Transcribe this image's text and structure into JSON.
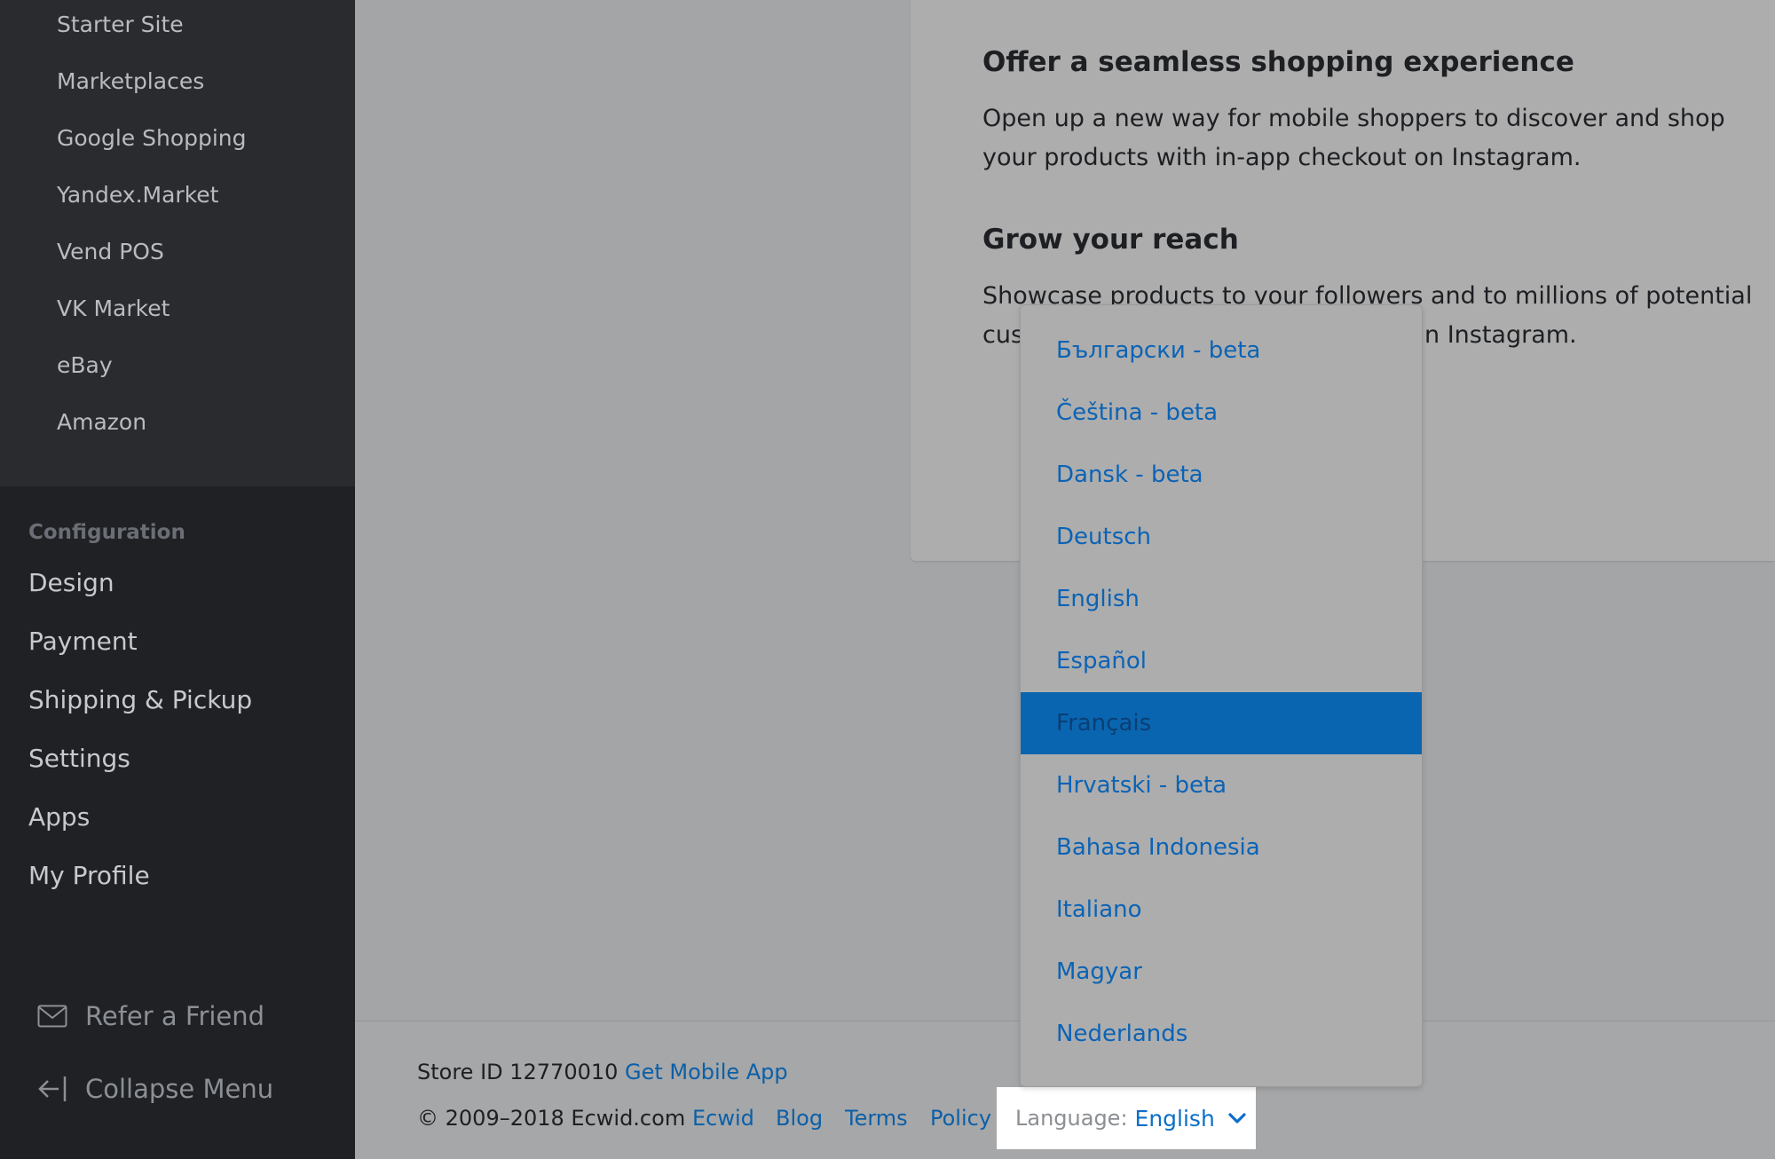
{
  "sidebar": {
    "channels": [
      "Starter Site",
      "Marketplaces",
      "Google Shopping",
      "Yandex.Market",
      "Vend POS",
      "VK Market",
      "eBay",
      "Amazon"
    ],
    "config_header": "Configuration",
    "config_items": [
      "Design",
      "Payment",
      "Shipping & Pickup",
      "Settings",
      "Apps",
      "My Profile"
    ],
    "refer_label": "Refer a Friend",
    "collapse_label": "Collapse Menu"
  },
  "card": {
    "section1_title": "Offer a seamless shopping experience",
    "section1_body": "Open up a new way for mobile shoppers to discover and shop your products with in-app checkout on Instagram.",
    "section2_title": "Grow your reach",
    "section2_line1": "Showcase products to your followers and to millions of potential",
    "section2_line2_start": "cus",
    "section2_line2_end": "n Instagram."
  },
  "footer": {
    "store_id": "Store ID 12770010",
    "mobile_app": "Get Mobile App",
    "copyright": "© 2009–2018 Ecwid.com",
    "links": [
      "Ecwid",
      "Blog",
      "Terms",
      "Policy"
    ],
    "language_label": "Language:",
    "language_value": "English"
  },
  "language_dropdown": {
    "selected": "Français",
    "options": [
      "Български - beta",
      "Čeština - beta",
      "Dansk - beta",
      "Deutsch",
      "English",
      "Español",
      "Français",
      "Hrvatski - beta",
      "Bahasa Indonesia",
      "Italiano",
      "Magyar",
      "Nederlands"
    ]
  },
  "colors": {
    "sidebar_bg": "#1f2125",
    "link_blue": "#0b63b5",
    "selected_bg": "#0a65b0"
  }
}
